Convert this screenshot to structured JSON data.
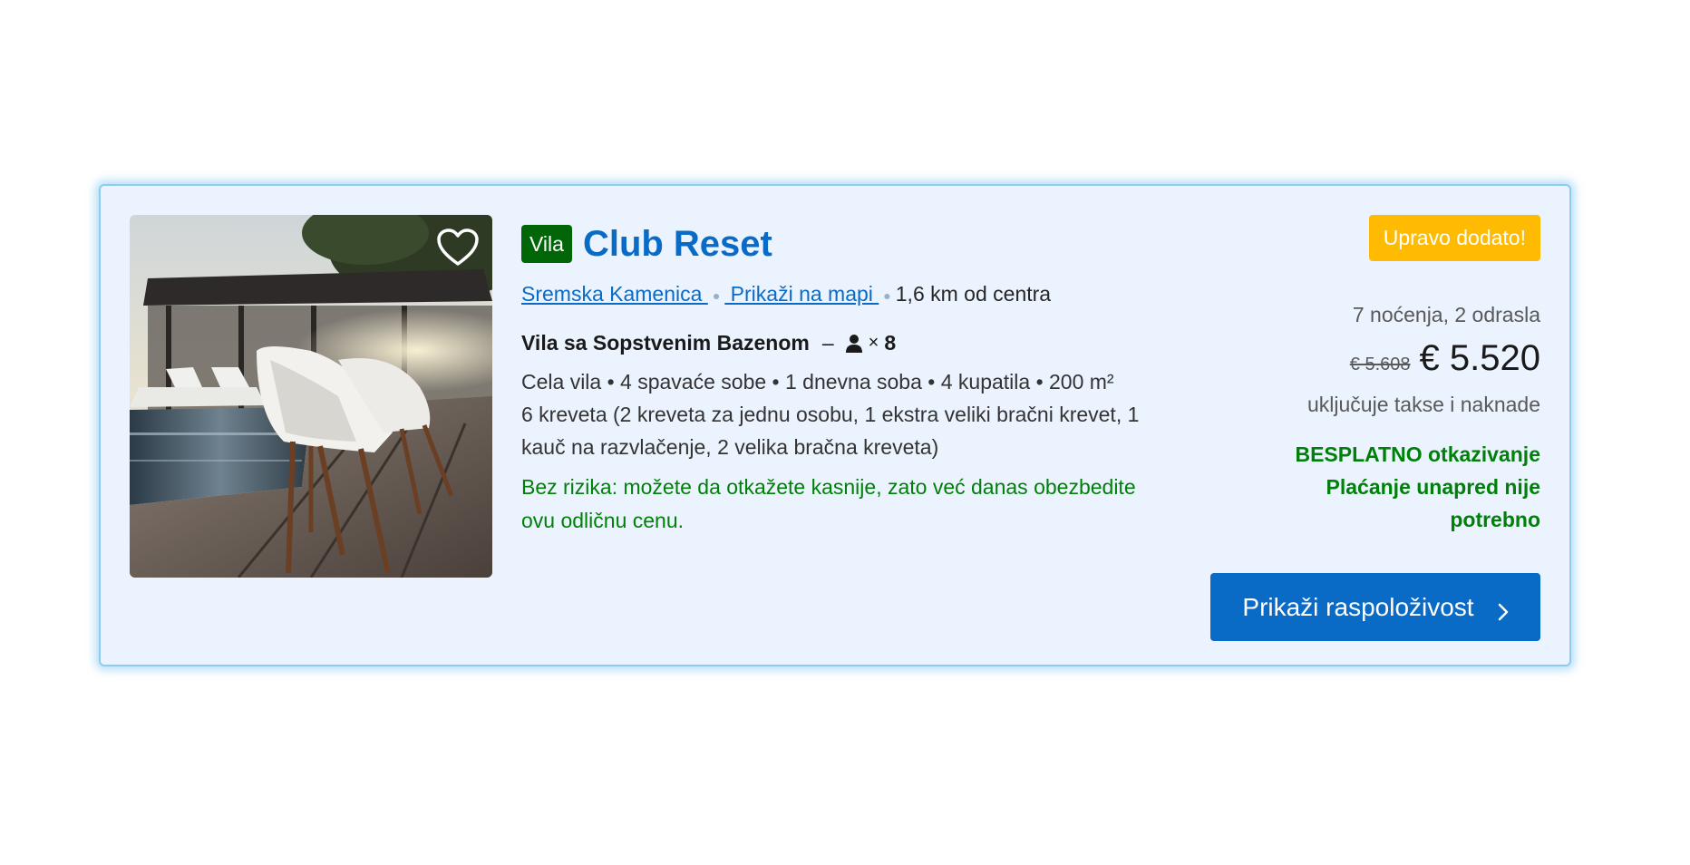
{
  "listing": {
    "type_badge": "Vila",
    "name": "Club Reset",
    "location": {
      "area_link": "Sremska Kamenica ",
      "map_link": " Prikaži na mapi ",
      "distance": "1,6 km od centra"
    },
    "room": {
      "name": "Vila sa Sopstvenim Bazenom",
      "dash": "–",
      "times": "×",
      "max_guests": "8",
      "details": "Cela vila • 4 spavaće sobe • 1 dnevna soba • 4 kupatila • 200 m²",
      "beds": "6 kreveta (2 kreveta za jednu osobu, 1 ekstra veliki bračni krevet, 1 kauč na razvlačenje, 2 velika bračna kreveta)"
    },
    "risk_free": "Bez rizika: možete da otkažete kasnije, zato već danas obezbedite ovu odličnu cenu."
  },
  "pricing": {
    "new_badge": "Upravo dodato!",
    "stay": "7 noćenja, 2 odrasla",
    "old_price": "€ 5.608",
    "price": "€ 5.520",
    "taxes": "uključuje takse i naknade",
    "free_cancel": "BESPLATNO otkazivanje",
    "no_prepay": "Plaćanje unapred nije potrebno"
  },
  "cta": {
    "label": "Prikaži raspoloživost"
  },
  "icons": {
    "favorite": "heart-outline-icon",
    "guests": "person-icon",
    "chevron": "chevron-right-icon"
  },
  "colors": {
    "brand_blue": "#0a6bc7",
    "green": "#008009",
    "badge_green": "#006607",
    "badge_yellow": "#febb02",
    "card_bg": "#ebf3ff"
  }
}
